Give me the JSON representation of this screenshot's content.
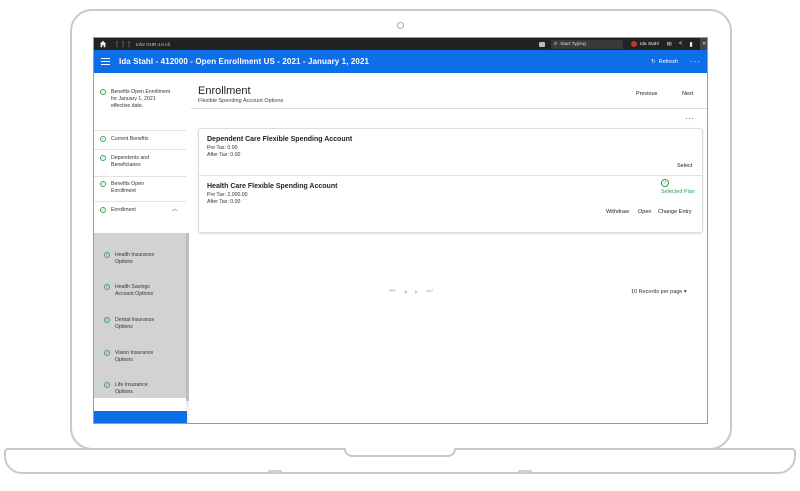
{
  "topbar": {
    "app_title": "Infor GHR 4.0 All",
    "search_placeholder": "Start Typing",
    "user_name": "Ida Stahl"
  },
  "header": {
    "title": "Ida Stahl - 412000 - Open Enrollment US - 2021 - January 1, 2021",
    "refresh_label": "Refresh",
    "more": "···"
  },
  "sidebar": {
    "items": [
      {
        "label": "Benefits Open Enrollment for January 1, 2021 effective date."
      },
      {
        "label": "Current Benefits"
      },
      {
        "label": "Dependents and Beneficiaries"
      },
      {
        "label": "Benefits Open Enrollment"
      },
      {
        "label": "Enrollment"
      }
    ],
    "sub_items": [
      {
        "label": "Health Insurance Options"
      },
      {
        "label": "Health Savings Account Options"
      },
      {
        "label": "Dental Insurance Options"
      },
      {
        "label": "Vision Insurance Options"
      },
      {
        "label": "Life Insurance Options"
      }
    ]
  },
  "main": {
    "title": "Enrollment",
    "subtitle": "Flexible Spending Account Options",
    "previous_label": "Previous",
    "next_label": "Next",
    "more": "···",
    "accounts": [
      {
        "title": "Dependent Care Flexible Spending Account",
        "pre_tax": "Pre Tax: 0.00",
        "after_tax": "After Tax: 0.00",
        "action": "Select"
      },
      {
        "title": "Health Care Flexible Spending Account",
        "pre_tax": "Pre Tax: 2,000.00",
        "after_tax": "After Tax: 0.00",
        "status": "Selected Plan",
        "actions": [
          "Withdraw",
          "Open",
          "Change Entry"
        ]
      }
    ],
    "records_per_page": "10 Records per page"
  },
  "colors": {
    "brand_blue": "#0d6ee8",
    "success_green": "#2e9e4f",
    "topbar_dark": "#222222"
  }
}
